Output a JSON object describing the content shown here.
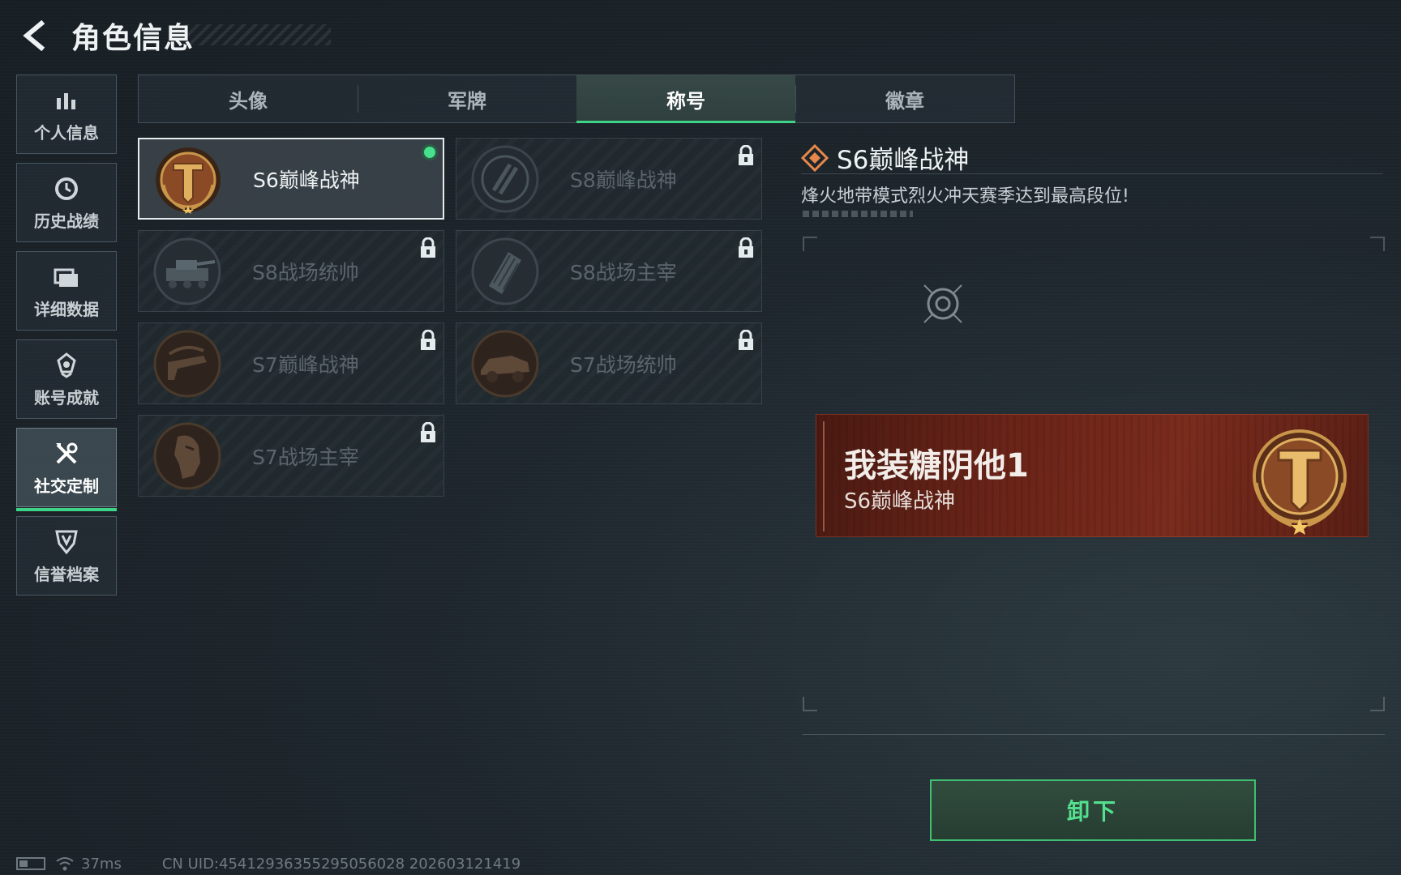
{
  "header": {
    "title": "角色信息",
    "back_icon": "back-arrow-icon"
  },
  "sidebar": {
    "items": [
      {
        "label": "个人信息",
        "icon": "bar-chart-icon",
        "active": false
      },
      {
        "label": "历史战绩",
        "icon": "history-clock-icon",
        "active": false
      },
      {
        "label": "详细数据",
        "icon": "folder-icon",
        "active": false
      },
      {
        "label": "账号成就",
        "icon": "medal-icon",
        "active": false
      },
      {
        "label": "社交定制",
        "icon": "tools-icon",
        "active": true
      },
      {
        "label": "信誉档案",
        "icon": "shield-icon",
        "active": false
      }
    ]
  },
  "tabs": [
    {
      "label": "头像",
      "active": false
    },
    {
      "label": "军牌",
      "active": false
    },
    {
      "label": "称号",
      "active": true
    },
    {
      "label": "徽章",
      "active": false
    }
  ],
  "titles": [
    {
      "label": "S6巅峰战神",
      "locked": false,
      "equipped": true,
      "selected": true
    },
    {
      "label": "S8巅峰战神",
      "locked": true,
      "equipped": false,
      "selected": false
    },
    {
      "label": "S8战场统帅",
      "locked": true,
      "equipped": false,
      "selected": false
    },
    {
      "label": "S8战场主宰",
      "locked": true,
      "equipped": false,
      "selected": false
    },
    {
      "label": "S7巅峰战神",
      "locked": true,
      "equipped": false,
      "selected": false
    },
    {
      "label": "S7战场统帅",
      "locked": true,
      "equipped": false,
      "selected": false
    },
    {
      "label": "S7战场主宰",
      "locked": true,
      "equipped": false,
      "selected": false
    }
  ],
  "detail": {
    "name": "S6巅峰战神",
    "description": "烽火地带模式烈火冲天赛季达到最高段位!"
  },
  "preview": {
    "player_name": "我装糖阴他1",
    "title": "S6巅峰战神"
  },
  "actions": {
    "unequip_label": "卸下"
  },
  "status": {
    "ping": "37ms",
    "uid": "CN UID:454129363552950560​28  202603121419"
  },
  "colors": {
    "accent": "#3fd38a",
    "preview_bg": "#6b2418",
    "badge_gold": "#c9964a"
  }
}
